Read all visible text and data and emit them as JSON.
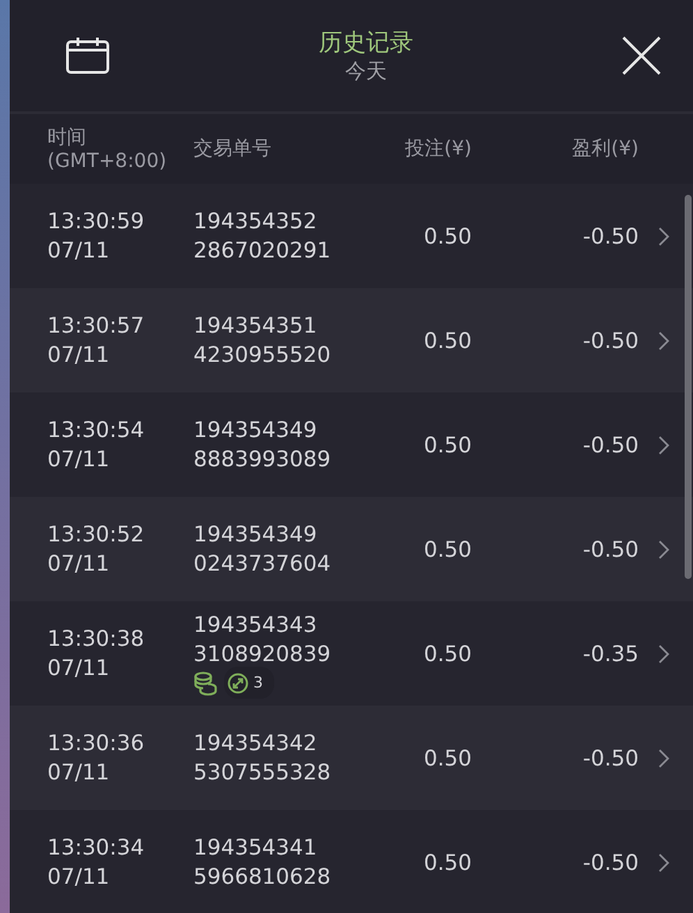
{
  "header": {
    "title": "历史记录",
    "subtitle": "今天"
  },
  "columns": [
    {
      "line1": "时间",
      "line2": "(GMT+8:00)"
    },
    {
      "line1": "交易单号"
    },
    {
      "line1": "投注(¥)"
    },
    {
      "line1": "盈利(¥)"
    }
  ],
  "rows": [
    {
      "time": "13:30:59",
      "date": "07/11",
      "order_1": "194354352",
      "order_2": "2867020291",
      "bet": "0.50",
      "profit": "-0.50"
    },
    {
      "time": "13:30:57",
      "date": "07/11",
      "order_1": "194354351",
      "order_2": "4230955520",
      "bet": "0.50",
      "profit": "-0.50"
    },
    {
      "time": "13:30:54",
      "date": "07/11",
      "order_1": "194354349",
      "order_2": "8883993089",
      "bet": "0.50",
      "profit": "-0.50"
    },
    {
      "time": "13:30:52",
      "date": "07/11",
      "order_1": "194354349",
      "order_2": "0243737604",
      "bet": "0.50",
      "profit": "-0.50"
    },
    {
      "time": "13:30:38",
      "date": "07/11",
      "order_1": "194354343",
      "order_2": "3108920839",
      "bet": "0.50",
      "profit": "-0.35",
      "badge": {
        "count": "3"
      }
    },
    {
      "time": "13:30:36",
      "date": "07/11",
      "order_1": "194354342",
      "order_2": "5307555328",
      "bet": "0.50",
      "profit": "-0.50"
    },
    {
      "time": "13:30:34",
      "date": "07/11",
      "order_1": "194354341",
      "order_2": "5966810628",
      "bet": "0.50",
      "profit": "-0.50"
    }
  ]
}
